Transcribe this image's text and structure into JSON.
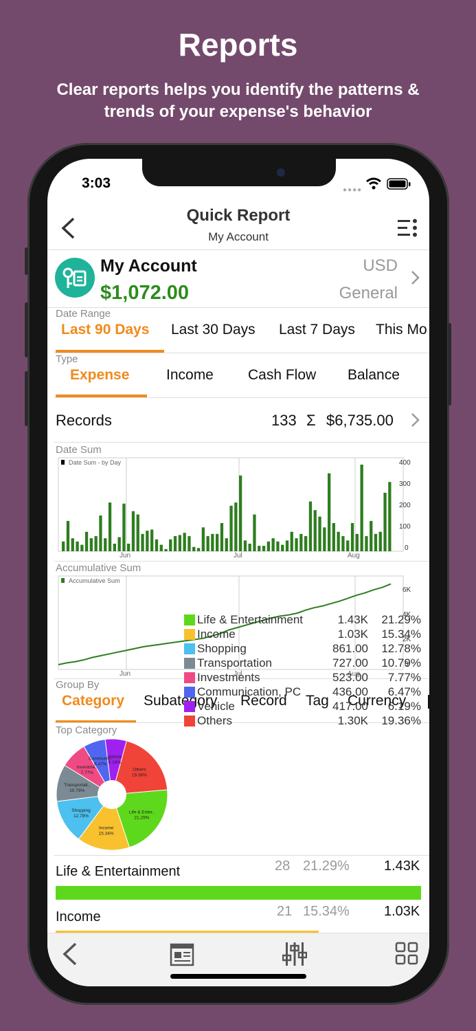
{
  "promo": {
    "title": "Reports",
    "subtitle_line1": "Clear reports helps you identify the patterns &",
    "subtitle_line2": "trends of your expense's behavior"
  },
  "status_bar": {
    "time": "3:03"
  },
  "nav": {
    "title": "Quick Report",
    "subtitle": "My Account"
  },
  "account": {
    "name": "My Account",
    "balance": "$1,072.00",
    "currency": "USD",
    "group": "General",
    "icon_color": "#1fb39a",
    "balance_color": "#2e8b1e"
  },
  "date_range": {
    "label": "Date Range",
    "options": [
      "Last 90 Days",
      "Last 30 Days",
      "Last 7 Days",
      "This Mo"
    ],
    "selected": "Last 90 Days"
  },
  "type": {
    "label": "Type",
    "options": [
      "Expense",
      "Income",
      "Cash Flow",
      "Balance"
    ],
    "selected": "Expense"
  },
  "records": {
    "label": "Records",
    "count": "133",
    "sigma": "Σ",
    "total": "$6,735.00"
  },
  "date_sum_chart": {
    "section_label": "Date Sum",
    "legend": "Date Sum - by Day",
    "x_labels": [
      "Jun",
      "Jul",
      "Aug"
    ],
    "y_labels": [
      "400",
      "300",
      "200",
      "100",
      "0"
    ]
  },
  "accum_chart": {
    "section_label": "Accumulative Sum",
    "legend": "Accumulative Sum",
    "x_labels": [
      "Jun",
      "Jul",
      "Aug"
    ],
    "y_labels": [
      "6K",
      "4K",
      "2K",
      "0"
    ]
  },
  "group_by": {
    "label": "Group By",
    "options": [
      "Category",
      "Subategory",
      "Record",
      "Tag",
      "Currency"
    ],
    "selected": "Category"
  },
  "top_category": {
    "label": "Top Category",
    "pie_labels": [
      {
        "name": "Life & Enter..",
        "pct": "21.29%"
      },
      {
        "name": "Income",
        "pct": "15.34%"
      },
      {
        "name": "Shopping",
        "pct": "12.78%"
      },
      {
        "name": "Transportati..",
        "pct": "10.79%"
      },
      {
        "name": "Investme..",
        "pct": "7.77%"
      },
      {
        "name": "Communic..",
        "pct": "6.47%"
      },
      {
        "name": "Vehicle",
        "pct": "6.19%"
      },
      {
        "name": "Others",
        "pct": "19.36%"
      }
    ],
    "legend": [
      {
        "name": "Life & Entertainment",
        "amount": "1.43K",
        "pct": "21.29%",
        "color": "#5ed81c"
      },
      {
        "name": "Income",
        "amount": "1.03K",
        "pct": "15.34%",
        "color": "#f9c12e"
      },
      {
        "name": "Shopping",
        "amount": "861.00",
        "pct": "12.78%",
        "color": "#4cc0ee"
      },
      {
        "name": "Transportation",
        "amount": "727.00",
        "pct": "10.79%",
        "color": "#7c8b93"
      },
      {
        "name": "Investments",
        "amount": "523.00",
        "pct": "7.77%",
        "color": "#f04a84"
      },
      {
        "name": "Communication, PC",
        "amount": "436.00",
        "pct": "6.47%",
        "color": "#5066f0"
      },
      {
        "name": "Vehicle",
        "amount": "417.00",
        "pct": "6.19%",
        "color": "#a020f0"
      },
      {
        "name": "Others",
        "amount": "1.30K",
        "pct": "19.36%",
        "color": "#f04438"
      }
    ]
  },
  "category_list": [
    {
      "name": "Life & Entertainment",
      "count": "28",
      "pct": "21.29%",
      "amount": "1.43K",
      "bar_color": "#5ed81c",
      "fill": 1.0
    },
    {
      "name": "Income",
      "count": "21",
      "pct": "15.34%",
      "amount": "1.03K",
      "bar_color": "#f9c12e",
      "fill": 0.72
    }
  ],
  "chart_data": [
    {
      "type": "bar",
      "title": "Date Sum - by Day",
      "x_axis": "date (Jun–Aug)",
      "ylim": [
        0,
        400
      ],
      "values": [
        45,
        140,
        60,
        45,
        30,
        90,
        60,
        70,
        165,
        60,
        225,
        35,
        65,
        220,
        35,
        185,
        170,
        80,
        95,
        100,
        55,
        30,
        10,
        55,
        70,
        75,
        85,
        70,
        20,
        15,
        110,
        70,
        80,
        80,
        130,
        60,
        210,
        225,
        350,
        50,
        35,
        170,
        25,
        25,
        45,
        60,
        45,
        30,
        50,
        90,
        60,
        80,
        70,
        230,
        190,
        160,
        110,
        360,
        130,
        90,
        70,
        50,
        130,
        80,
        400,
        70,
        140,
        80,
        90,
        270,
        320
      ],
      "color": "#2e7d1f"
    },
    {
      "type": "line",
      "title": "Accumulative Sum",
      "x_axis": "date (Jun–Aug)",
      "ylim": [
        0,
        7000
      ],
      "values": [
        0,
        150,
        250,
        400,
        600,
        750,
        900,
        1050,
        1200,
        1350,
        1500,
        1600,
        1700,
        1800,
        1900,
        2000,
        2100,
        2200,
        2400,
        2600,
        2900,
        3100,
        3300,
        3500,
        3700,
        3900,
        4050,
        4150,
        4300,
        4550,
        4750,
        4900,
        5100,
        5300,
        5550,
        5800,
        6000,
        6250,
        6450,
        6735
      ],
      "color": "#2e7d1f"
    },
    {
      "type": "pie",
      "title": "Top Category",
      "categories": [
        "Life & Entertainment",
        "Income",
        "Shopping",
        "Transportation",
        "Investments",
        "Communication, PC",
        "Vehicle",
        "Others"
      ],
      "values": [
        21.29,
        15.34,
        12.78,
        10.79,
        7.77,
        6.47,
        6.19,
        19.36
      ],
      "colors": [
        "#5ed81c",
        "#f9c12e",
        "#4cc0ee",
        "#7c8b93",
        "#f04a84",
        "#5066f0",
        "#a020f0",
        "#f04438"
      ]
    }
  ],
  "toolbar": {
    "icons": [
      "back-icon",
      "report-icon",
      "sliders-icon",
      "grid-icon"
    ]
  }
}
